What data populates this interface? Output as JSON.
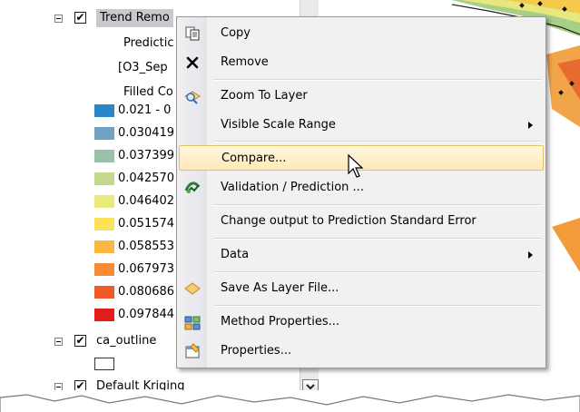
{
  "toc": {
    "layer1": {
      "name": "Trend Remo",
      "checked": "✔"
    },
    "layer1_sub": [
      "Predictic",
      "[O3_Sep",
      "Filled Co"
    ],
    "legend": [
      {
        "label": "0.021 - 0",
        "color": "#2b86c7"
      },
      {
        "label": "0.030419",
        "color": "#6fa3c0"
      },
      {
        "label": "0.037399",
        "color": "#99c2a8"
      },
      {
        "label": "0.042570",
        "color": "#c4d98c"
      },
      {
        "label": "0.046402",
        "color": "#e8ea7a"
      },
      {
        "label": "0.051574",
        "color": "#fbe25a"
      },
      {
        "label": "0.058553",
        "color": "#fbb643"
      },
      {
        "label": "0.067973",
        "color": "#f78a33"
      },
      {
        "label": "0.080686",
        "color": "#f15a26"
      },
      {
        "label": "0.097844",
        "color": "#e31c1c"
      }
    ],
    "layer2": {
      "name": "ca_outline",
      "checked": "✔"
    },
    "layer3": {
      "name": "Default Kriging",
      "checked": "✔"
    }
  },
  "menu": {
    "items": [
      {
        "label": "Copy",
        "icon": "copy-icon"
      },
      {
        "label": "Remove",
        "icon": "remove-icon"
      },
      {
        "label": "Zoom To Layer",
        "icon": "zoom-to-layer-icon"
      },
      {
        "label": "Visible Scale Range",
        "submenu": true
      },
      {
        "label": "Compare...",
        "highlighted": true
      },
      {
        "label": "Validation / Prediction ...",
        "icon": "validation-icon"
      },
      {
        "label": "Change output to Prediction Standard Error"
      },
      {
        "label": "Data",
        "submenu": true
      },
      {
        "label": "Save As Layer File...",
        "icon": "layer-file-icon"
      },
      {
        "label": "Method Properties...",
        "icon": "method-properties-icon"
      },
      {
        "label": "Properties...",
        "icon": "properties-icon"
      }
    ]
  },
  "colors": {
    "highlight": "#fdeab7",
    "menu_bg": "#f1f1f1"
  }
}
